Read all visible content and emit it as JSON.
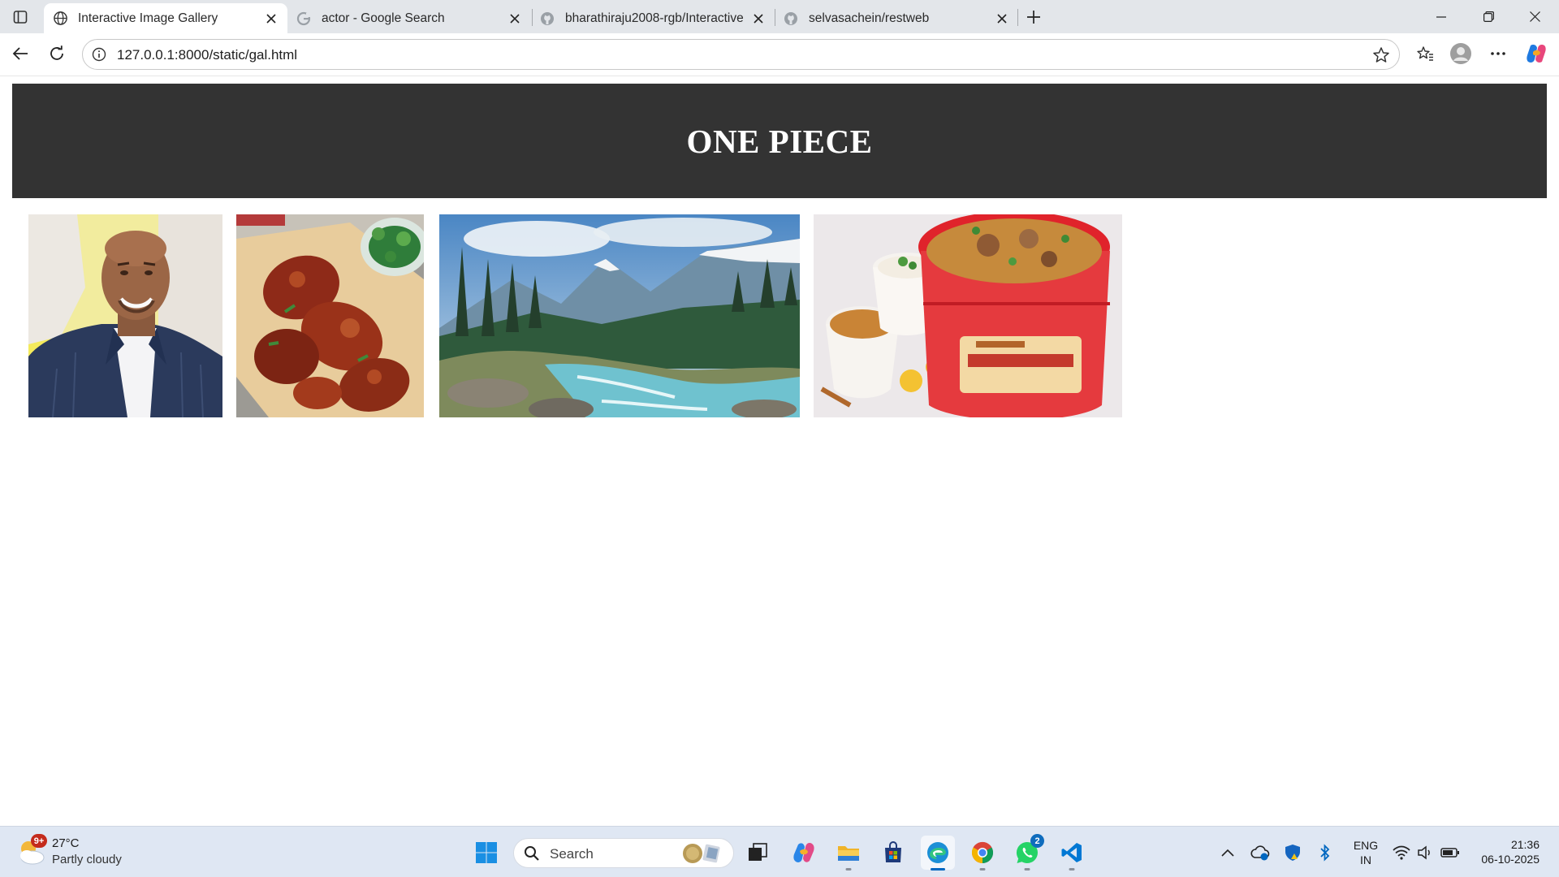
{
  "browser": {
    "tabs": [
      {
        "title": "Interactive Image Gallery",
        "favicon": "globe-icon",
        "active": true
      },
      {
        "title": "actor - Google Search",
        "favicon": "google-g-icon",
        "active": false
      },
      {
        "title": "bharathiraju2008-rgb/Interactive",
        "favicon": "github-icon",
        "active": false
      },
      {
        "title": "selvasachein/restweb",
        "favicon": "github-icon",
        "active": false
      }
    ],
    "address": {
      "url": "127.0.0.1:8000/static/gal.html"
    },
    "accent": "#0067c0"
  },
  "page": {
    "title": "ONE PIECE",
    "header_color": "#333333",
    "images": [
      {
        "name": "actor-photo"
      },
      {
        "name": "chicken-photo"
      },
      {
        "name": "mountain-river-photo"
      },
      {
        "name": "biryani-bucket-photo"
      }
    ]
  },
  "taskbar": {
    "weather": {
      "temp": "27°C",
      "desc": "Partly cloudy",
      "badge": "9+"
    },
    "search": {
      "label": "Search"
    },
    "whatsapp_badge": "2",
    "language": {
      "line1": "ENG",
      "line2": "IN"
    },
    "clock": {
      "time": "21:36",
      "date": "06-10-2025"
    }
  }
}
